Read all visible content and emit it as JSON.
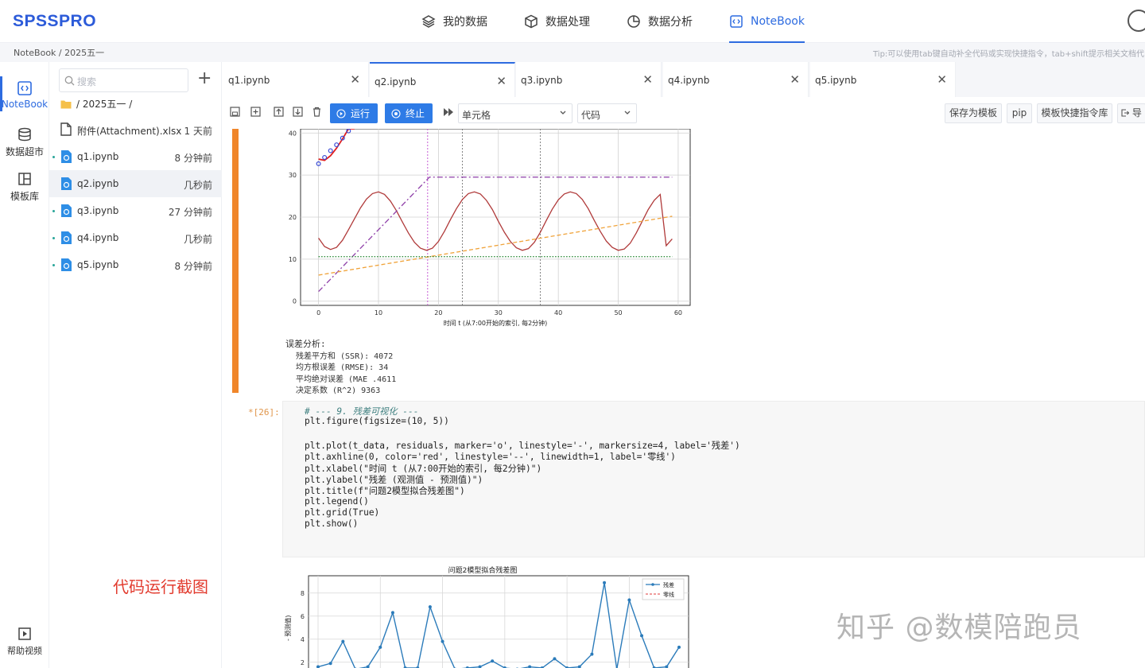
{
  "app": {
    "logo": "SPSSPRO"
  },
  "topnav": [
    {
      "label": "我的数据",
      "icon": "layers-icon",
      "active": false
    },
    {
      "label": "数据处理",
      "icon": "cube-icon",
      "active": false
    },
    {
      "label": "数据分析",
      "icon": "pie-icon",
      "active": false
    },
    {
      "label": "NoteBook",
      "icon": "code-icon",
      "active": true
    }
  ],
  "breadcrumb": "NoteBook / 2025五一",
  "tip": "Tip:可以使用tab键自动补全代码或实现快捷指令，tab+shift提示相关文档代",
  "rail": [
    {
      "label": "NoteBook",
      "icon": "notebook-icon"
    },
    {
      "label": "数据超市",
      "icon": "database-icon"
    },
    {
      "label": "模板库",
      "icon": "template-icon"
    }
  ],
  "help": "帮助视频",
  "filepanel": {
    "search_placeholder": "搜索",
    "add": "+",
    "folder": "/ 2025五一 /",
    "files": [
      {
        "name": "附件(Attachment).xlsx",
        "time": "1 天前",
        "type": "file"
      },
      {
        "name": "q1.ipynb",
        "time": "8 分钟前",
        "type": "nb"
      },
      {
        "name": "q2.ipynb",
        "time": "几秒前",
        "type": "nb"
      },
      {
        "name": "q3.ipynb",
        "time": "27 分钟前",
        "type": "nb"
      },
      {
        "name": "q4.ipynb",
        "time": "几秒前",
        "type": "nb"
      },
      {
        "name": "q5.ipynb",
        "time": "8 分钟前",
        "type": "nb"
      }
    ]
  },
  "tabs": [
    {
      "label": "q1.ipynb"
    },
    {
      "label": "q2.ipynb"
    },
    {
      "label": "q3.ipynb"
    },
    {
      "label": "q4.ipynb"
    },
    {
      "label": "q5.ipynb"
    }
  ],
  "toolbar": {
    "run": "运行",
    "stop": "终止",
    "cell_scope": "单元格",
    "cell_type": "代码",
    "save_template": "保存为模板",
    "pip": "pip",
    "snippets": "模板快捷指令库",
    "export": "导"
  },
  "output": {
    "err_title": "误差分析:",
    "err_lines": [
      "残差平方和 (SSR):   4072",
      "均方根误差 (RMSE):   34",
      "平均绝对误差 (MAE   .4611",
      "决定系数 (R^2)    9363"
    ]
  },
  "cell": {
    "prompt": "*[26]:",
    "code": [
      "# --- 9. 残差可视化 ---",
      "plt.figure(figsize=(10, 5))",
      "",
      "plt.plot(t_data, residuals, marker='o', linestyle='-', markersize=4, label='残差')",
      "plt.axhline(0, color='red', linestyle='--', linewidth=1, label='零线')",
      "plt.xlabel(\"时间 t (从7:00开始的索引, 每2分钟)\")",
      "plt.ylabel(\"残差 (观测值 - 预测值)\")",
      "plt.title(f\"问题2模型拟合残差图\")",
      "plt.legend()",
      "plt.grid(True)",
      "plt.show()"
    ]
  },
  "annotation": "代码运行截图",
  "watermark": "知乎 @数模陪跑员",
  "chart_data": [
    {
      "type": "line",
      "title": "",
      "xlabel": "时间 t (从7:00开始的索引, 每2分钟)",
      "ylabel": "",
      "xlim": [
        -3,
        62
      ],
      "ylim": [
        -1,
        41
      ],
      "xticks": [
        0,
        10,
        20,
        30,
        40,
        50,
        60
      ],
      "yticks": [
        0,
        10,
        20,
        30,
        40
      ],
      "vlines": [
        18.2,
        24,
        37
      ],
      "series": [
        {
          "style": "sine",
          "color": "#b03a3a",
          "x": [
            0,
            1,
            2,
            3,
            4,
            5,
            6,
            7,
            8,
            9,
            10,
            11,
            12,
            13,
            14,
            15,
            16,
            17,
            18,
            19,
            20,
            21,
            22,
            23,
            24,
            25,
            26,
            27,
            28,
            29,
            30,
            31,
            32,
            33,
            34,
            35,
            36,
            37,
            38,
            39,
            40,
            41,
            42,
            43,
            44,
            45,
            46,
            47,
            48,
            49,
            50,
            51,
            52,
            53,
            54,
            55,
            56,
            57,
            58,
            59
          ],
          "y": [
            15,
            13,
            12.3,
            12.8,
            14.5,
            17,
            19.6,
            22.2,
            24.3,
            25.6,
            26,
            25.4,
            23.8,
            21.5,
            18.8,
            16.2,
            14,
            12.6,
            12.1,
            12.6,
            14.2,
            16.6,
            19.4,
            22,
            24.2,
            25.6,
            26,
            25.5,
            24,
            21.8,
            19,
            16.4,
            14.2,
            12.7,
            12.1,
            12.5,
            14,
            16.4,
            19.2,
            21.9,
            24.1,
            25.5,
            26,
            25.6,
            24.2,
            22,
            19.2,
            16.6,
            14.3,
            12.8,
            12.1,
            12.4,
            13.8,
            16.2,
            19,
            21.8,
            24,
            25.4,
            13.2,
            14.8
          ]
        },
        {
          "style": "dashdot",
          "color": "#8e3fa8",
          "x": [
            0,
            18.5,
            59
          ],
          "y": [
            2.3,
            29.5,
            29.5
          ]
        },
        {
          "style": "dashed",
          "color": "#f0a33a",
          "x": [
            0,
            59
          ],
          "y": [
            6.2,
            20.2
          ]
        },
        {
          "style": "dotted",
          "color": "#2e8b3a",
          "x": [
            0,
            59
          ],
          "y": [
            10.6,
            10.6
          ]
        },
        {
          "style": "fit",
          "color": "#e02020",
          "x": [
            0,
            1,
            2,
            3,
            4,
            5,
            6
          ],
          "y": [
            33.8,
            33.5,
            34.6,
            36.4,
            38.6,
            41,
            43.5
          ]
        },
        {
          "style": "points",
          "color": "#3b4cd6",
          "x": [
            0,
            1,
            2,
            3,
            4,
            5
          ],
          "y": [
            32.7,
            34.2,
            35.8,
            37.2,
            38.8,
            40.5
          ]
        }
      ]
    },
    {
      "type": "line",
      "title": "问题2模型拟合残差图",
      "ylabel": "- 预测值)",
      "legend": [
        "残差",
        "零线"
      ],
      "ylim": [
        1.5,
        9.5
      ],
      "yticks": [
        2,
        4,
        6,
        8
      ],
      "series": [
        {
          "name": "残差",
          "color": "#2b7bba",
          "x": [
            0,
            1,
            2,
            3,
            4,
            5,
            6,
            7,
            8,
            9,
            10,
            11,
            12,
            13,
            14,
            15,
            16,
            17,
            18,
            19,
            20,
            21,
            22,
            23,
            24,
            25,
            26,
            27,
            28,
            29
          ],
          "y": [
            1.6,
            1.9,
            3.8,
            1.4,
            1.6,
            3.3,
            6.3,
            1.5,
            1.5,
            6.8,
            3.8,
            1.4,
            1.5,
            1.6,
            2.1,
            1.5,
            1.4,
            1.6,
            1.5,
            2.3,
            1.5,
            1.6,
            2.7,
            8.9,
            1.4,
            7.4,
            4.3,
            1.5,
            1.6,
            3.3
          ]
        },
        {
          "name": "零线",
          "color": "#e03a3a",
          "x": [
            0,
            29
          ],
          "y": [
            0,
            0
          ]
        }
      ]
    }
  ]
}
